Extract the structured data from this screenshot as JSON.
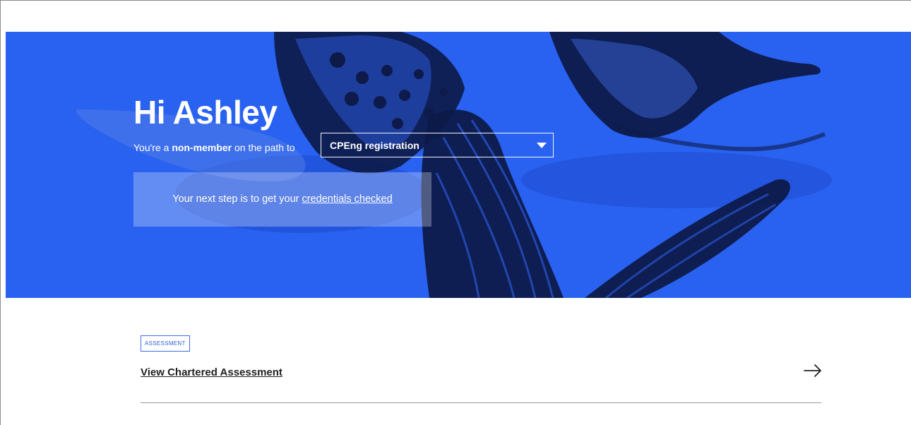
{
  "hero": {
    "greeting": "Hi Ashley",
    "status_prefix": "You're a ",
    "status_member": "non-member",
    "status_suffix": " on the path to",
    "path_select_value": "CPEng registration",
    "next_step_prefix": "Your next step is to get your ",
    "next_step_link": "credentials checked"
  },
  "assessment": {
    "tag": "ASSESSMENT",
    "link_label": "View Chartered Assessment"
  },
  "icons": {
    "dropdown": "caret-down-icon",
    "arrow": "arrow-right-icon",
    "hero_image": "butterflies-image"
  },
  "colors": {
    "hero_blue": "#2962f0",
    "art_dark": "#0d1a4a",
    "tag_blue": "#2f5fd8"
  }
}
